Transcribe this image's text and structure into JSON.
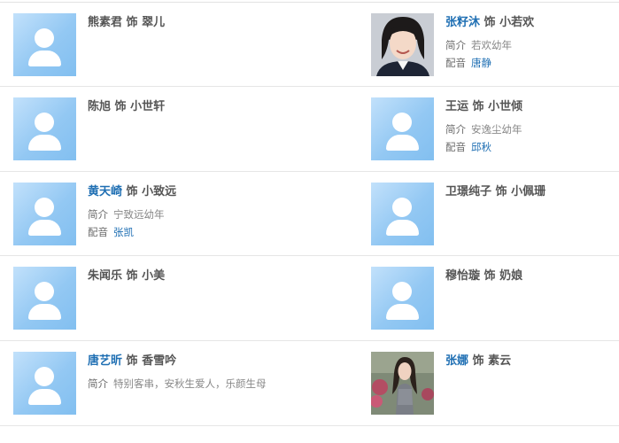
{
  "cast": [
    {
      "actor": "熊素君",
      "sep": "饰",
      "role": "翠儿"
    },
    {
      "actor": "张籽沐",
      "sep": "饰",
      "role": "小若欢",
      "intro_label": "简介",
      "intro": "若欢幼年",
      "voice_label": "配音",
      "voice": "唐静"
    },
    {
      "actor": "陈旭",
      "sep": "饰",
      "role": "小世轩"
    },
    {
      "actor": "王运",
      "sep": "饰",
      "role": "小世倾",
      "intro_label": "简介",
      "intro": "安逸尘幼年",
      "voice_label": "配音",
      "voice": "邱秋"
    },
    {
      "actor": "黄天崎",
      "sep": "饰",
      "role": "小致远",
      "intro_label": "简介",
      "intro": "宁致远幼年",
      "voice_label": "配音",
      "voice": "张凯"
    },
    {
      "actor": "卫璟纯子",
      "sep": "饰",
      "role": "小佩珊"
    },
    {
      "actor": "朱闻乐",
      "sep": "饰",
      "role": "小美"
    },
    {
      "actor": "穆怡璇",
      "sep": "饰",
      "role": "奶娘"
    },
    {
      "actor": "唐艺昕",
      "sep": "饰",
      "role": "香雪吟",
      "intro_label": "简介",
      "intro": "特别客串，安秋生爱人，乐颜生母"
    },
    {
      "actor": "张娜",
      "sep": "饰",
      "role": "素云"
    }
  ],
  "colors": {
    "link": "#1f6fb3",
    "text": "#555555",
    "avatar_bg": "#93c8f3"
  },
  "icons": {
    "placeholder": "person-placeholder-icon",
    "photo": "actor-photo"
  }
}
